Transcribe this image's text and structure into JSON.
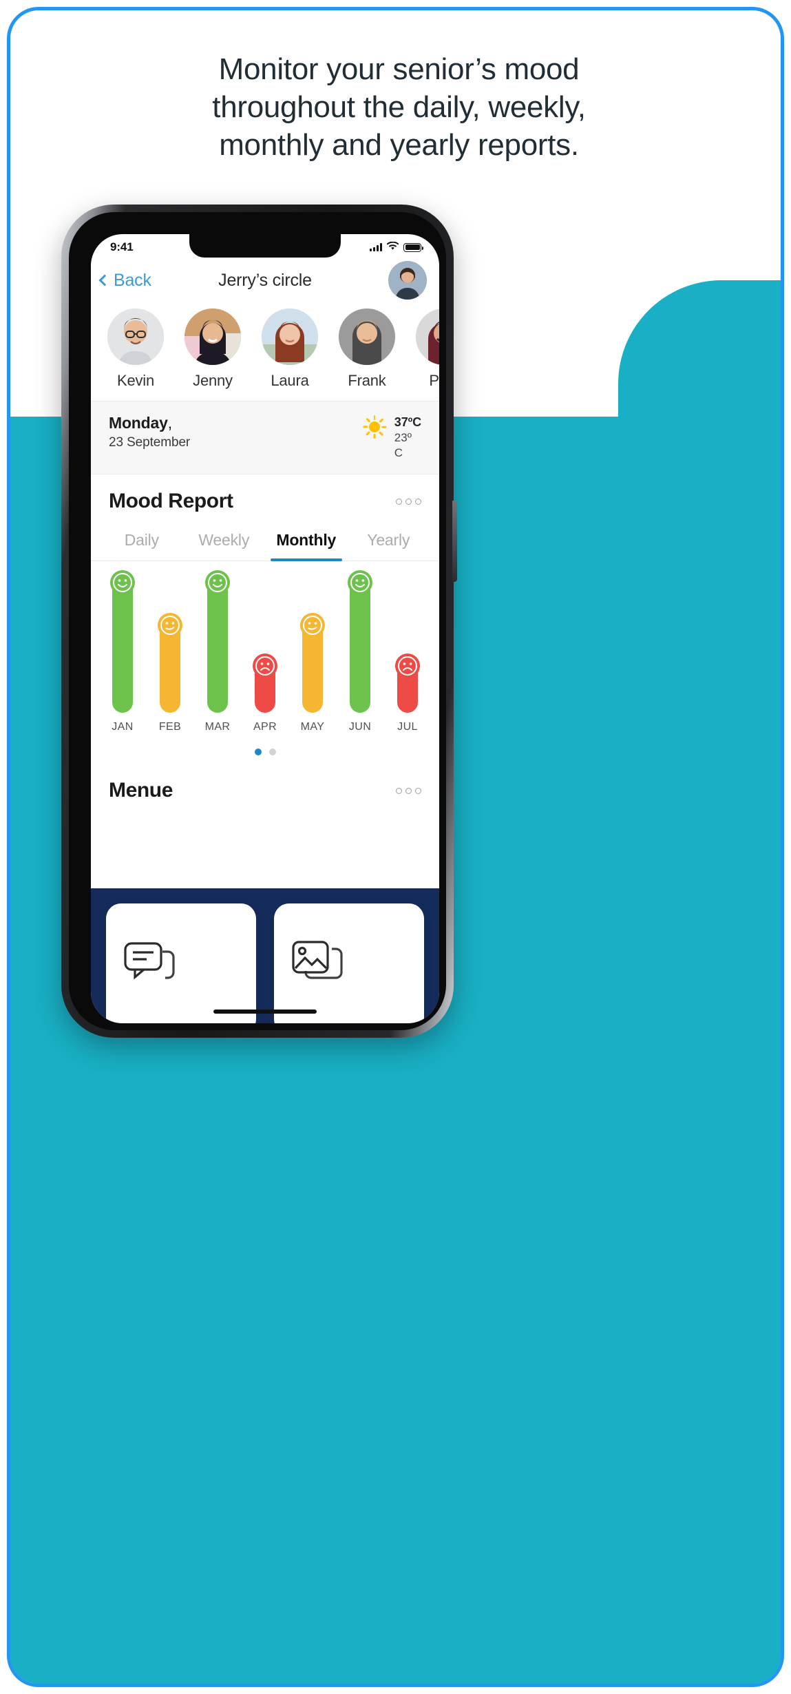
{
  "headline": {
    "line1": "Monitor your senior’s mood",
    "line2": "throughout the daily, weekly,",
    "line3": "monthly and yearly reports."
  },
  "colors": {
    "frame_blue": "#2196F3",
    "blob_teal": "#19AFC4",
    "accent_blue": "#1B87C9",
    "link_blue": "#3B9BD4",
    "headline_navy": "#222E36",
    "bottom_navy": "#152C5B",
    "mood_good": "#6CC24A",
    "mood_ok": "#F5B731",
    "mood_bad": "#EE4B46"
  },
  "phone": {
    "statusbar": {
      "time": "9:41",
      "signal_icon": "cellular-bars-icon",
      "wifi_icon": "wifi-icon",
      "battery_icon": "battery-full-icon"
    },
    "navbar": {
      "back_label": "Back",
      "back_icon": "chevron-left-icon",
      "title": "Jerry’s circle",
      "avatar": "profile-avatar"
    },
    "contacts": [
      {
        "name": "Kevin"
      },
      {
        "name": "Jenny"
      },
      {
        "name": "Laura"
      },
      {
        "name": "Frank"
      },
      {
        "name": "Paul"
      }
    ],
    "daterow": {
      "day": "Monday",
      "day_suffix": ",",
      "date": "23 September",
      "weather_icon": "sun-icon",
      "temp_high": "37ºC",
      "temp_low": "23º",
      "temp_unit": "C"
    },
    "mood_report": {
      "title": "Mood Report",
      "menu_icon": "more-options-icon",
      "tabs": [
        {
          "label": "Daily",
          "active": false
        },
        {
          "label": "Weekly",
          "active": false
        },
        {
          "label": "Monthly",
          "active": true
        },
        {
          "label": "Yearly",
          "active": false
        }
      ],
      "pager": {
        "count": 2,
        "active_index": 0
      }
    },
    "menue": {
      "title": "Menue",
      "menu_icon": "more-options-icon"
    },
    "bottom_cards": [
      {
        "icon": "chat-message-icon"
      },
      {
        "icon": "photo-gallery-icon"
      }
    ]
  },
  "chart_data": {
    "type": "bar",
    "title": "Mood Report",
    "xlabel": "",
    "ylabel": "",
    "categories": [
      "JAN",
      "FEB",
      "MAR",
      "APR",
      "MAY",
      "JUN",
      "JUL"
    ],
    "values": [
      100,
      68,
      100,
      38,
      68,
      100,
      38
    ],
    "ylim": [
      0,
      100
    ],
    "grid": false,
    "legend": "none",
    "moods": [
      "good",
      "ok",
      "good",
      "bad",
      "ok",
      "good",
      "bad"
    ],
    "bar_colors": [
      "#6CC24A",
      "#F5B731",
      "#6CC24A",
      "#EE4B46",
      "#F5B731",
      "#6CC24A",
      "#EE4B46"
    ],
    "face_icons": [
      "smile-face-icon",
      "neutral-face-icon",
      "smile-face-icon",
      "sad-face-icon",
      "neutral-face-icon",
      "smile-face-icon",
      "sad-face-icon"
    ]
  }
}
